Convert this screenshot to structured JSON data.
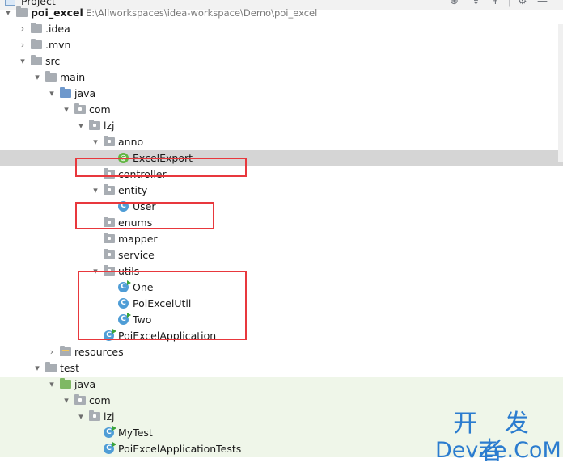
{
  "panel": {
    "title": "Project",
    "icons": [
      "locate-icon",
      "collapse-all-icon",
      "expand-all-icon",
      "settings-icon"
    ]
  },
  "tree": [
    {
      "label": "poi_excel",
      "path": "E:\\Allworkspaces\\idea-workspace\\Demo\\poi_excel",
      "arrow": "▾",
      "icon": "module-folder",
      "bold": true
    },
    {
      "label": ".idea",
      "arrow": "›",
      "icon": "folder"
    },
    {
      "label": ".mvn",
      "arrow": "›",
      "icon": "folder"
    },
    {
      "label": "src",
      "arrow": "▾",
      "icon": "folder"
    },
    {
      "label": "main",
      "arrow": "▾",
      "icon": "folder"
    },
    {
      "label": "java",
      "arrow": "▾",
      "icon": "source-folder"
    },
    {
      "label": "com",
      "arrow": "▾",
      "icon": "package"
    },
    {
      "label": "lzj",
      "arrow": "▾",
      "icon": "package"
    },
    {
      "label": "anno",
      "arrow": "▾",
      "icon": "package"
    },
    {
      "label": "ExcelExport",
      "arrow": "",
      "icon": "annotation",
      "selected": true
    },
    {
      "label": "controller",
      "arrow": "",
      "icon": "package"
    },
    {
      "label": "entity",
      "arrow": "▾",
      "icon": "package"
    },
    {
      "label": "User",
      "arrow": "",
      "icon": "class"
    },
    {
      "label": "enums",
      "arrow": "",
      "icon": "package"
    },
    {
      "label": "mapper",
      "arrow": "",
      "icon": "package"
    },
    {
      "label": "service",
      "arrow": "",
      "icon": "package"
    },
    {
      "label": "utils",
      "arrow": "▾",
      "icon": "package"
    },
    {
      "label": "One",
      "arrow": "",
      "icon": "class-runnable"
    },
    {
      "label": "PoiExcelUtil",
      "arrow": "",
      "icon": "class"
    },
    {
      "label": "Two",
      "arrow": "",
      "icon": "class-runnable"
    },
    {
      "label": "PoiExcelApplication",
      "arrow": "",
      "icon": "class-runnable"
    },
    {
      "label": "resources",
      "arrow": "›",
      "icon": "resources-folder"
    },
    {
      "label": "test",
      "arrow": "▾",
      "icon": "folder"
    },
    {
      "label": "java",
      "arrow": "▾",
      "icon": "test-folder",
      "test": true
    },
    {
      "label": "com",
      "arrow": "▾",
      "icon": "package",
      "test": true
    },
    {
      "label": "lzj",
      "arrow": "▾",
      "icon": "package",
      "test": true
    },
    {
      "label": "MyTest",
      "arrow": "",
      "icon": "class-runnable",
      "test": true
    },
    {
      "label": "PoiExcelApplicationTests",
      "arrow": "",
      "icon": "class-runnable",
      "test": true
    }
  ],
  "highlight_colors": {
    "box": "#e8383d",
    "selection": "#d5d5d5",
    "test_background": "#eff6e9"
  },
  "watermark": {
    "cn": "开 发 者",
    "en": "DevZe.CoM"
  }
}
